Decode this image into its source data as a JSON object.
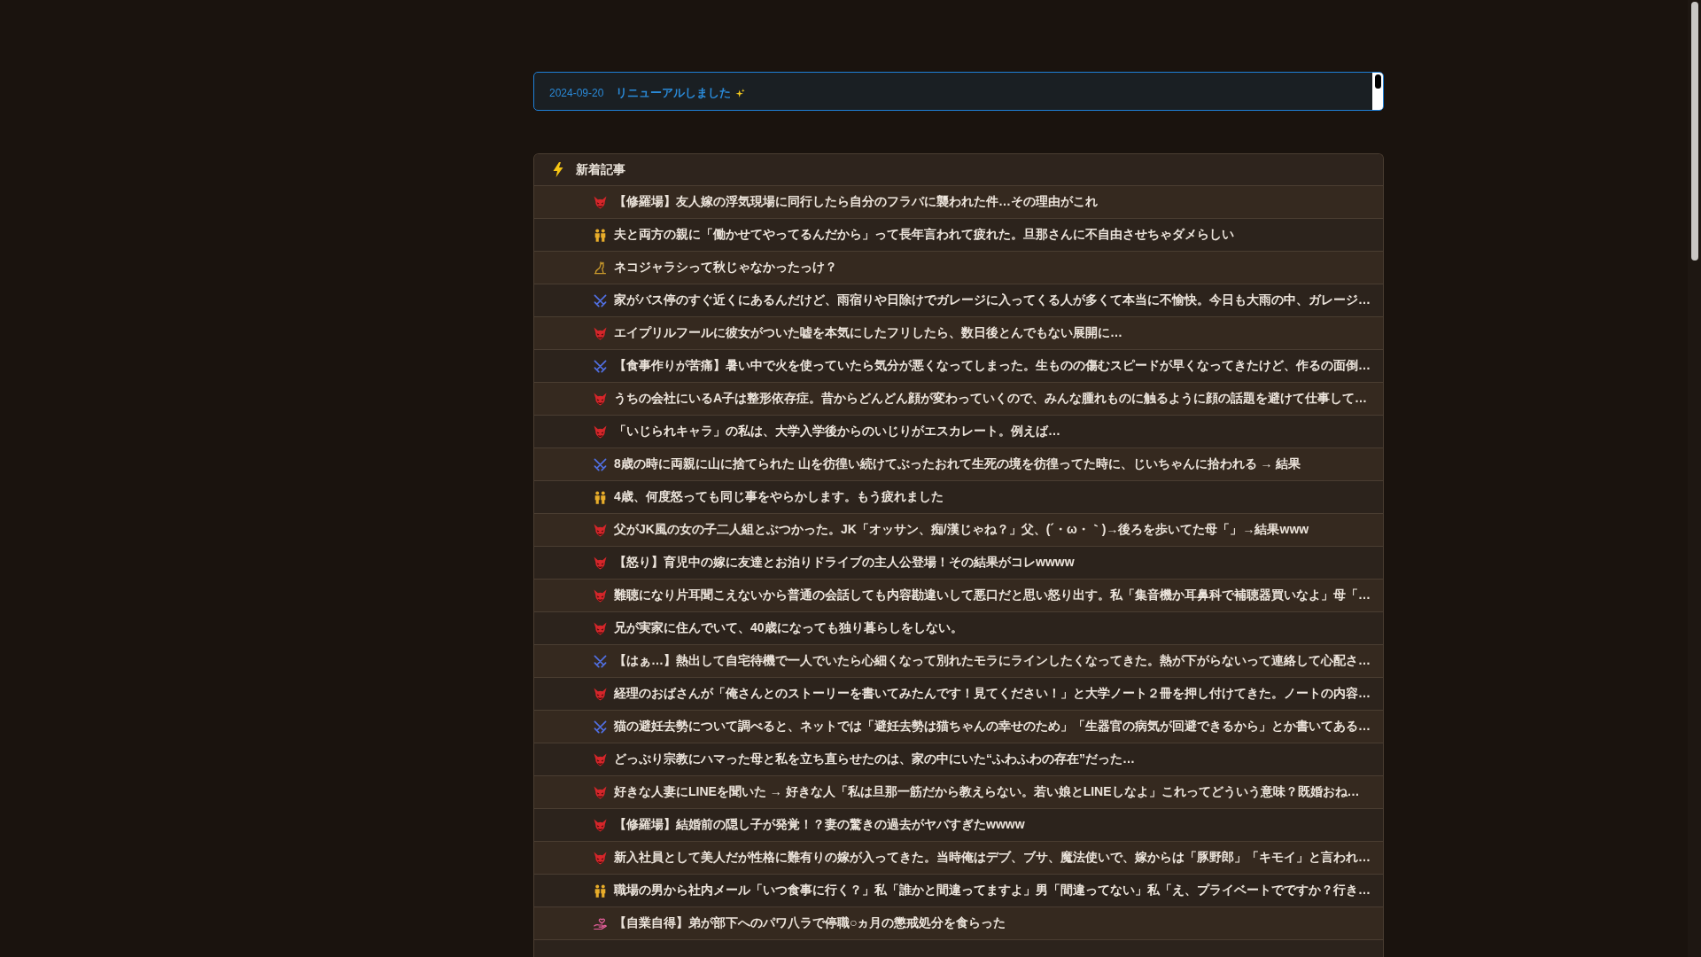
{
  "news": {
    "items": [
      {
        "date": "2024-09-20",
        "title": "リニューアルしました"
      }
    ]
  },
  "articles": {
    "title": "新着記事",
    "items": [
      {
        "kind": "devil",
        "title": "【修羅場】友人嫁の浮気現場に同行したら自分のフラバに襲われた件…その理由がこれ"
      },
      {
        "kind": "family",
        "title": "夫と両方の親に「働かせてやってるんだから」って長年言われて疲れた。旦那さんに不自由させちゃダメらしい"
      },
      {
        "kind": "cat",
        "title": "ネコジャラシって秋じゃなかったっけ？"
      },
      {
        "kind": "swords",
        "title": "家がバス停のすぐ近くにあるんだけど、雨宿りや日除けでガレージに入ってくる人が多くて本当に不愉快。今日も大雨の中、ガレージ…"
      },
      {
        "kind": "devil",
        "title": "エイプリルフールに彼女がついた嘘を本気にしたフリしたら、数日後とんでもない展開に…"
      },
      {
        "kind": "swords",
        "title": "【食事作りが苦痛】暑い中で火を使っていたら気分が悪くなってしまった。生ものの傷むスピードが早くなってきたけど、作るの面倒…"
      },
      {
        "kind": "devil",
        "title": "うちの会社にいるA子は整形依存症。昔からどんどん顔が変わっていくので、みんな腫れものに触るように顔の話題を避けて仕事して…"
      },
      {
        "kind": "devil",
        "title": "「いじられキャラ」の私は、大学入学後からのいじりがエスカレート。例えば…"
      },
      {
        "kind": "swords",
        "title": "8歳の時に両親に山に捨てられた 山を彷徨い続けてぶったおれて生死の境を彷徨ってた時に、じいちゃんに拾われる → 結果"
      },
      {
        "kind": "family",
        "title": "4歳、何度怒っても同じ事をやらかします。もう疲れました"
      },
      {
        "kind": "devil",
        "title": "父がJK風の女の子二人組とぶつかった。JK「オッサン、痴/漢じゃね？」父、(´・ω・｀)→後ろを歩いてた母「」→結果www"
      },
      {
        "kind": "devil",
        "title": "【怒り】育児中の嫁に友達とお泊りドライブの主人公登場！その結果がコレwwww"
      },
      {
        "kind": "devil",
        "title": "難聴になり片耳聞こえないから普通の会話しても内容勘違いして悪口だと思い怒り出す。私「集音機か耳鼻科で補聴器買いなよ」母「…"
      },
      {
        "kind": "devil",
        "title": "兄が実家に住んでいて、40歳になっても独り暮らしをしない。"
      },
      {
        "kind": "swords",
        "title": "【はぁ…】熱出して自宅待機で一人でいたら心細くなって別れたモラにラインしたくなってきた。熱が下がらないって連絡して心配さ…"
      },
      {
        "kind": "devil",
        "title": "経理のおばさんが「俺さんとのストーリーを書いてみたんです！見てください！」と大学ノート２冊を押し付けてきた。ノートの内容…"
      },
      {
        "kind": "swords",
        "title": "猫の避妊去勢について調べると、ネットでは「避妊去勢は猫ちゃんの幸せのため」「生器官の病気が回避できるから」とか書いてある…"
      },
      {
        "kind": "devil",
        "title": "どっぷり宗教にハマった母と私を立ち直らせたのは、家の中にいた“ふわふわの存在”だった…"
      },
      {
        "kind": "devil",
        "title": "好きな人妻にLINEを聞いた → 好きな人「私は旦那一筋だから教えらない。若い娘とLINEしなよ」これってどういう意味？既婚おね…"
      },
      {
        "kind": "devil",
        "title": "【修羅場】結婚前の隠し子が発覚！？妻の驚きの過去がヤバすぎたwwww"
      },
      {
        "kind": "devil",
        "title": "新入社員として美人だが性格に難有りの嫁が入ってきた。当時俺はデブ、ブサ、魔法使いで、嫁からは「豚野郎」「キモイ」と言われ…"
      },
      {
        "kind": "family",
        "title": "職場の男から社内メール「いつ食事に行く？」私「誰かと間違ってますよ」男「間違ってない」私「え、プライベートでですか？行き…"
      },
      {
        "kind": "hand",
        "title": "【自業自得】弟が部下へのパワ八ラで停職○ヵ月の懲戒処分を食らった"
      }
    ]
  }
}
